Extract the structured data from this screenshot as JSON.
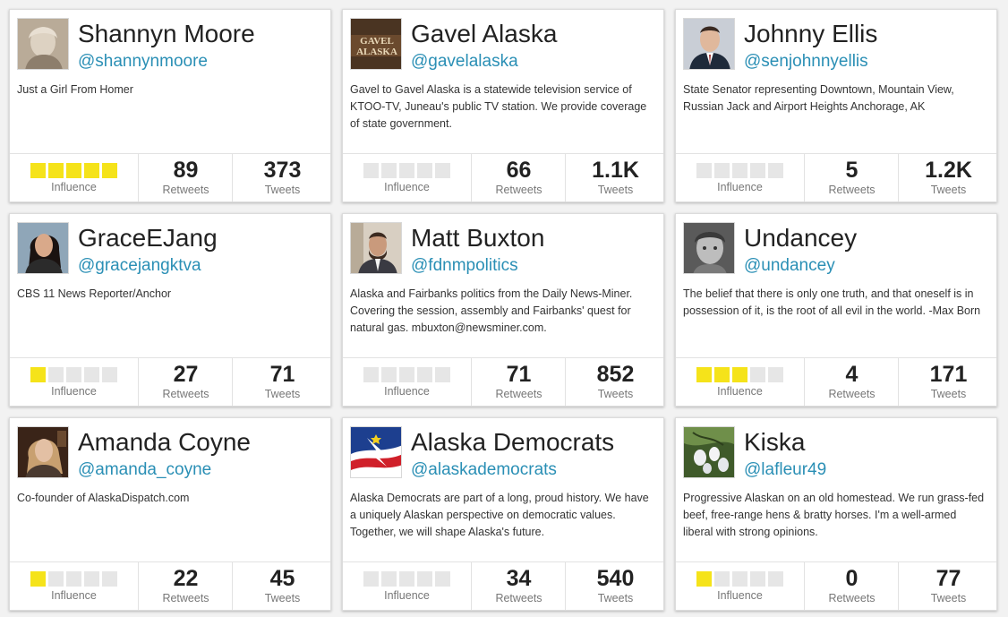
{
  "labels": {
    "influence": "Influence",
    "retweets": "Retweets",
    "tweets": "Tweets"
  },
  "colors": {
    "handle": "#2a8fb5",
    "influence_on": "#f5e31a",
    "influence_off": "#e6e6e6"
  },
  "cards": [
    {
      "name": "Shannyn Moore",
      "handle": "@shannynmoore",
      "bio": "Just a Girl From Homer",
      "influence": 5,
      "retweets": "89",
      "tweets": "373",
      "avatar": "portrait-photo"
    },
    {
      "name": "Gavel Alaska",
      "handle": "@gavelalaska",
      "bio": "Gavel to Gavel Alaska is a statewide television service of KTOO-TV, Juneau's public TV station. We provide coverage of state government.",
      "influence": 0,
      "retweets": "66",
      "tweets": "1.1K",
      "avatar": "logo",
      "avatar_text": "GAVEL ALASKA"
    },
    {
      "name": "Johnny Ellis",
      "handle": "@senjohnnyellis",
      "bio": "State Senator representing Downtown, Mountain View, Russian Jack and Airport Heights Anchorage, AK",
      "influence": 0,
      "retweets": "5",
      "tweets": "1.2K",
      "avatar": "portrait-photo"
    },
    {
      "name": "GraceEJang",
      "handle": "@gracejangktva",
      "bio": "CBS 11 News Reporter/Anchor",
      "influence": 1,
      "retweets": "27",
      "tweets": "71",
      "avatar": "portrait-photo"
    },
    {
      "name": "Matt Buxton",
      "handle": "@fdnmpolitics",
      "bio": "Alaska and Fairbanks politics from the Daily News-Miner. Covering the session, assembly and Fairbanks' quest for natural gas. mbuxton@newsminer.com.",
      "influence": 0,
      "retweets": "71",
      "tweets": "852",
      "avatar": "portrait-photo"
    },
    {
      "name": "Undancey",
      "handle": "@undancey",
      "bio": "The belief that there is only one truth, and that oneself is in possession of it, is the root of all evil in the world. -Max Born",
      "influence": 3,
      "retweets": "4",
      "tweets": "171",
      "avatar": "portrait-photo"
    },
    {
      "name": "Amanda Coyne",
      "handle": "@amanda_coyne",
      "bio": "Co-founder of AlaskaDispatch.com",
      "influence": 1,
      "retweets": "22",
      "tweets": "45",
      "avatar": "portrait-photo"
    },
    {
      "name": "Alaska Democrats",
      "handle": "@alaskademocrats",
      "bio": "Alaska Democrats are part of a long, proud history. We have a uniquely Alaskan perspective on democratic values. Together, we will shape Alaska's future.",
      "influence": 0,
      "retweets": "34",
      "tweets": "540",
      "avatar": "logo"
    },
    {
      "name": "Kiska",
      "handle": "@lafleur49",
      "bio": "Progressive Alaskan on an old homestead. We run grass-fed beef, free-range hens & bratty horses. I'm a well-armed liberal with strong opinions.",
      "influence": 1,
      "retweets": "0",
      "tweets": "77",
      "avatar": "flower-photo"
    }
  ]
}
